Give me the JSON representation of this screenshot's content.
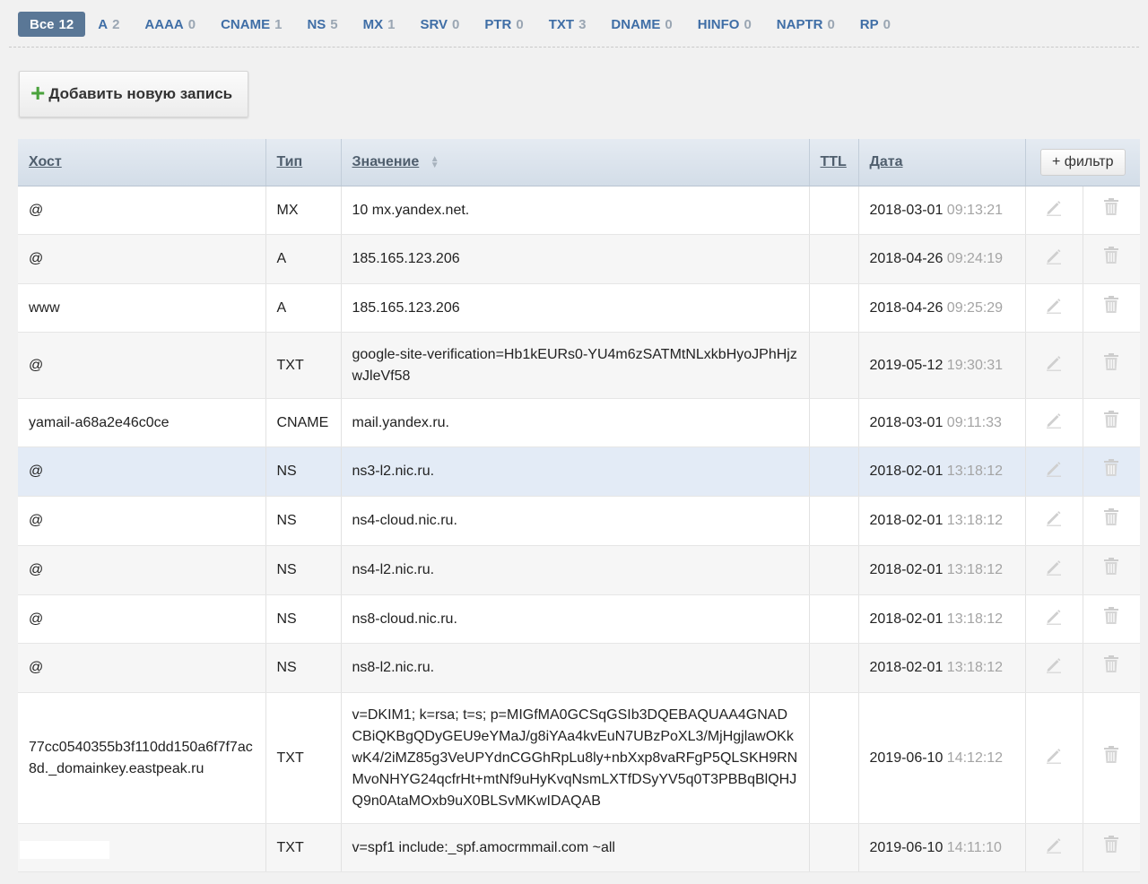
{
  "tabs": [
    {
      "label": "Все",
      "count": "12",
      "active": true
    },
    {
      "label": "A",
      "count": "2"
    },
    {
      "label": "AAAA",
      "count": "0"
    },
    {
      "label": "CNAME",
      "count": "1"
    },
    {
      "label": "NS",
      "count": "5"
    },
    {
      "label": "MX",
      "count": "1"
    },
    {
      "label": "SRV",
      "count": "0"
    },
    {
      "label": "PTR",
      "count": "0"
    },
    {
      "label": "TXT",
      "count": "3"
    },
    {
      "label": "DNAME",
      "count": "0"
    },
    {
      "label": "HINFO",
      "count": "0"
    },
    {
      "label": "NAPTR",
      "count": "0"
    },
    {
      "label": "RP",
      "count": "0"
    }
  ],
  "add_button": {
    "plus": "+",
    "label": "Добавить новую запись"
  },
  "table": {
    "headers": {
      "host": "Хост",
      "type": "Тип",
      "value": "Значение",
      "ttl": "TTL",
      "date": "Дата"
    },
    "filter_label": "+ фильтр",
    "rows": [
      {
        "host": "@",
        "type": "MX",
        "value": "10 mx.yandex.net.",
        "date": "2018-03-01",
        "time": "09:13:21"
      },
      {
        "host": "@",
        "type": "A",
        "value": "185.165.123.206",
        "date": "2018-04-26",
        "time": "09:24:19"
      },
      {
        "host": "www",
        "type": "A",
        "value": "185.165.123.206",
        "date": "2018-04-26",
        "time": "09:25:29"
      },
      {
        "host": "@",
        "type": "TXT",
        "value": "google-site-verification=Hb1kEURs0-YU4m6zSATMtNLxkbHyoJPhHjzwJleVf58",
        "date": "2019-05-12",
        "time": "19:30:31"
      },
      {
        "host": "yamail-a68a2e46c0ce",
        "type": "CNAME",
        "value": "mail.yandex.ru.",
        "date": "2018-03-01",
        "time": "09:11:33"
      },
      {
        "host": "@",
        "type": "NS",
        "value": "ns3-l2.nic.ru.",
        "date": "2018-02-01",
        "time": "13:18:12",
        "highlight": true
      },
      {
        "host": "@",
        "type": "NS",
        "value": "ns4-cloud.nic.ru.",
        "date": "2018-02-01",
        "time": "13:18:12"
      },
      {
        "host": "@",
        "type": "NS",
        "value": "ns4-l2.nic.ru.",
        "date": "2018-02-01",
        "time": "13:18:12"
      },
      {
        "host": "@",
        "type": "NS",
        "value": "ns8-cloud.nic.ru.",
        "date": "2018-02-01",
        "time": "13:18:12"
      },
      {
        "host": "@",
        "type": "NS",
        "value": "ns8-l2.nic.ru.",
        "date": "2018-02-01",
        "time": "13:18:12"
      },
      {
        "host": "77cc0540355b3f110dd150a6f7f7ac8d._domainkey.eastpeak.ru",
        "type": "TXT",
        "value": "v=DKIM1; k=rsa; t=s; p=MIGfMA0GCSqGSIb3DQEBAQUAA4GNADCBiQKBgQDyGEU9eYMaJ/g8iYAa4kvEuN7UBzPoXL3/MjHgjlawOKkwK4/2iMZ85g3VeUPYdnCGGhRpLu8ly+nbXxp8vaRFgP5QLSKH9RNMvoNHYG24qcfrHt+mtNf9uHyKvqNsmLXTfDSyYV5q0T3PBBqBlQHJQ9n0AtaMOxb9uX0BLSvMKwIDAQAB",
        "date": "2019-06-10",
        "time": "14:12:12"
      },
      {
        "host": "",
        "type": "TXT",
        "value": "v=spf1 include:_spf.amocrmmail.com ~all",
        "date": "2019-06-10",
        "time": "14:11:10"
      }
    ]
  },
  "icons": {
    "edit": "pencil-icon",
    "delete": "trash-icon"
  },
  "colors": {
    "tab_active_bg": "#5a7796",
    "tab_link": "#3f6ea6",
    "add_plus": "#4aa23c",
    "row_highlight": "#e3ebf6"
  }
}
